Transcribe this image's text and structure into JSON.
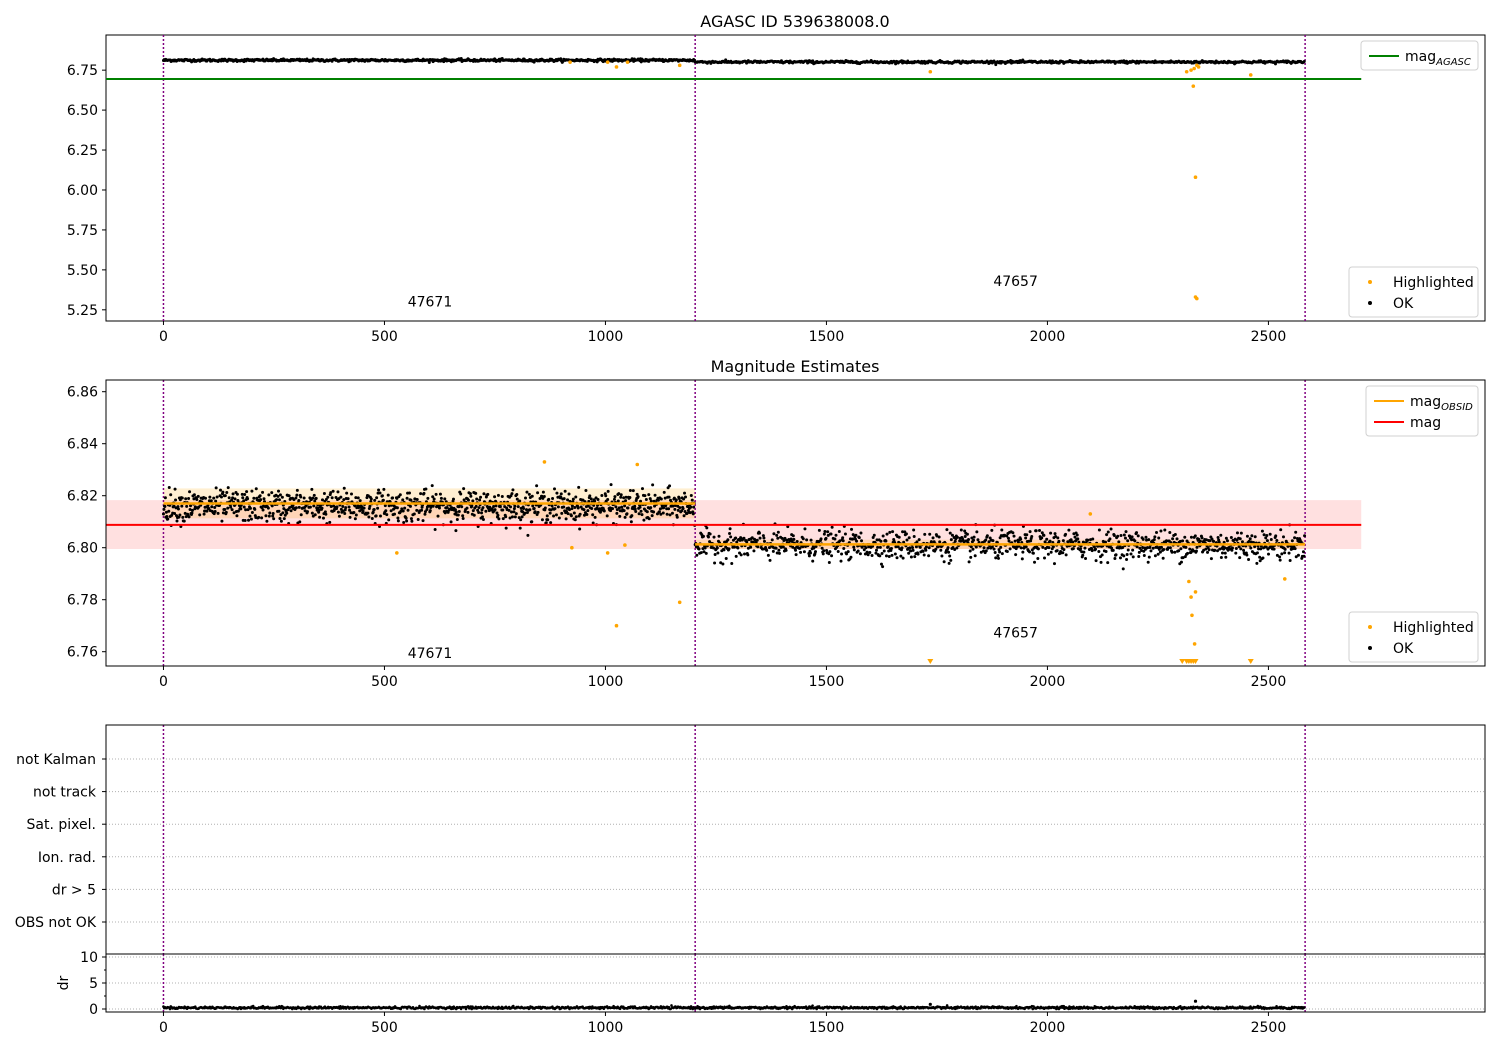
{
  "chart_data": [
    {
      "type": "scatter",
      "title": "AGASC ID 539638008.0",
      "xlim": [
        -130,
        2990
      ],
      "ylim": [
        5.18,
        6.97
      ],
      "xticks": [
        "0",
        "500",
        "1000",
        "1500",
        "2000",
        "2500"
      ],
      "yticks": [
        "5.25",
        "5.50",
        "5.75",
        "6.00",
        "6.25",
        "6.50",
        "6.75"
      ],
      "grid": false,
      "obsid_boundaries": [
        0,
        1203,
        2583
      ],
      "obsid_labels": [
        {
          "text": "47671",
          "x": 603,
          "y": 5.27
        },
        {
          "text": "47657",
          "x": 1928,
          "y": 5.4
        }
      ],
      "reference_line": {
        "name": "mag",
        "subscript": "AGASC",
        "value": 6.695,
        "x_range": [
          -130,
          2710
        ],
        "color": "#008000"
      },
      "series": [
        {
          "name": "Highlighted",
          "color": "#ffa500",
          "points": [
            [
              920,
              6.8
            ],
            [
              1005,
              6.8
            ],
            [
              1025,
              6.77
            ],
            [
              1050,
              6.8
            ],
            [
              1168,
              6.78
            ],
            [
              1735,
              6.74
            ],
            [
              2315,
              6.74
            ],
            [
              2325,
              6.75
            ],
            [
              2330,
              6.65
            ],
            [
              2332,
              6.76
            ],
            [
              2335,
              6.08
            ],
            [
              2338,
              6.78
            ],
            [
              2342,
              6.77
            ],
            [
              2335,
              5.33
            ],
            [
              2338,
              5.32
            ],
            [
              2460,
              6.72
            ]
          ]
        },
        {
          "name": "OK",
          "color": "#000000",
          "segments": [
            {
              "x_range": [
                0,
                1203
              ],
              "y_base": 6.812,
              "y_spread": 0.008
            },
            {
              "x_range": [
                1203,
                2583
              ],
              "y_base": 6.801,
              "y_spread": 0.008
            }
          ]
        }
      ],
      "legends": [
        {
          "position": "top-right",
          "entries": [
            {
              "label": "mag",
              "subscript": "AGASC",
              "color": "#008000",
              "kind": "line"
            }
          ]
        },
        {
          "position": "bottom-right",
          "entries": [
            {
              "label": "Highlighted",
              "color": "#ffa500",
              "kind": "dot"
            },
            {
              "label": "OK",
              "color": "#000000",
              "kind": "dot"
            }
          ]
        }
      ]
    },
    {
      "type": "scatter",
      "title": "Magnitude Estimates",
      "xlim": [
        -130,
        2990
      ],
      "ylim": [
        6.7545,
        6.8645
      ],
      "xticks": [
        "0",
        "500",
        "1000",
        "1500",
        "2000",
        "2500"
      ],
      "yticks": [
        "6.76",
        "6.78",
        "6.80",
        "6.82",
        "6.84",
        "6.86"
      ],
      "grid": false,
      "obsid_boundaries": [
        0,
        1203,
        2583
      ],
      "obsid_labels": [
        {
          "text": "47671",
          "x": 603,
          "y": 6.7575
        },
        {
          "text": "47657",
          "x": 1928,
          "y": 6.7655
        }
      ],
      "mag_line": {
        "name": "mag",
        "value": 6.8088,
        "band": [
          6.7995,
          6.8183
        ],
        "x_range": [
          -130,
          2710
        ],
        "color": "#ff0000"
      },
      "obsid_mags": [
        {
          "name": "mag",
          "subscript": "OBSID",
          "x_range": [
            0,
            1203
          ],
          "value": 6.817,
          "band": [
            6.8113,
            6.8228
          ],
          "color": "#ffa500"
        },
        {
          "name": "mag",
          "subscript": "OBSID",
          "x_range": [
            1203,
            2583
          ],
          "value": 6.8013,
          "band": [
            6.7995,
            6.8031
          ],
          "color": "#ffa500"
        }
      ],
      "series": [
        {
          "name": "Highlighted",
          "color": "#ffa500",
          "points": [
            [
              528,
              6.798
            ],
            [
              862,
              6.833
            ],
            [
              924,
              6.8
            ],
            [
              1005,
              6.798
            ],
            [
              1025,
              6.77
            ],
            [
              1044,
              6.801
            ],
            [
              1072,
              6.832
            ],
            [
              1168,
              6.779
            ],
            [
              2097,
              6.813
            ],
            [
              2320,
              6.787
            ],
            [
              2325,
              6.781
            ],
            [
              2327,
              6.774
            ],
            [
              2335,
              6.783
            ],
            [
              2333,
              6.763
            ],
            [
              2537,
              6.788
            ]
          ]
        },
        {
          "name": "OK",
          "color": "#000000",
          "segments": [
            {
              "x_range": [
                0,
                1203
              ],
              "y_base": 6.816,
              "y_spread": 0.006
            },
            {
              "x_range": [
                1203,
                2583
              ],
              "y_base": 6.801,
              "y_spread": 0.0055
            }
          ]
        }
      ],
      "clipped_markers": {
        "color": "#ffa500",
        "x": [
          1735,
          2305,
          2315,
          2320,
          2325,
          2330,
          2335,
          2460
        ]
      },
      "legends": [
        {
          "position": "top-right",
          "entries": [
            {
              "label": "mag",
              "subscript": "OBSID",
              "color": "#ffa500",
              "kind": "line"
            },
            {
              "label": "mag",
              "subscript": "",
              "color": "#ff0000",
              "kind": "line"
            }
          ]
        },
        {
          "position": "bottom-right",
          "entries": [
            {
              "label": "Highlighted",
              "color": "#ffa500",
              "kind": "dot"
            },
            {
              "label": "OK",
              "color": "#000000",
              "kind": "dot"
            }
          ]
        }
      ]
    },
    {
      "type": "scatter",
      "title": "",
      "xlim": [
        -130,
        2990
      ],
      "categories": [
        "not Kalman",
        "not track",
        "Sat. pixel.",
        "Ion. rad.",
        "dr > 5",
        "OBS not OK"
      ],
      "grid": true,
      "obsid_boundaries": [
        0,
        1203,
        2583
      ]
    },
    {
      "type": "scatter",
      "title": "",
      "xlim": [
        -130,
        2990
      ],
      "ylim": [
        0,
        10
      ],
      "ylabel": "dr",
      "xticks": [
        "0",
        "500",
        "1000",
        "1500",
        "2000",
        "2500"
      ],
      "yticks": [
        "0",
        "5",
        "10"
      ],
      "grid": true,
      "obsid_boundaries": [
        0,
        1203,
        2583
      ],
      "series": [
        {
          "name": "dr",
          "color": "#000000",
          "y_base": 0.25,
          "y_spread": 0.12,
          "x_range": [
            0,
            2583
          ],
          "spikes": [
            [
              1735,
              0.9
            ],
            [
              2335,
              1.5
            ]
          ]
        }
      ]
    }
  ]
}
